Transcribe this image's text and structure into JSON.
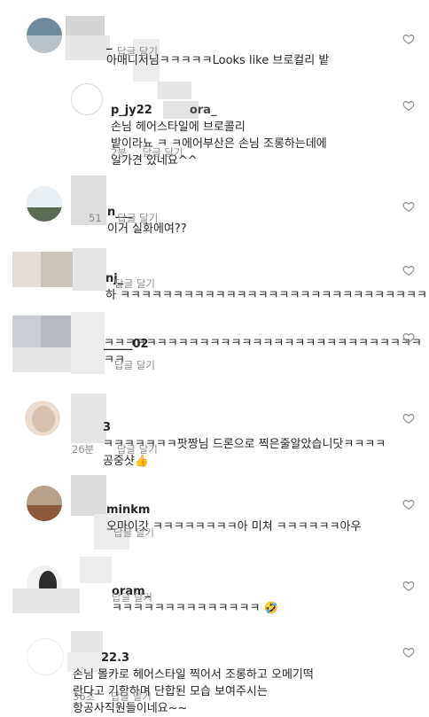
{
  "comments": [
    {
      "username": "_",
      "text": "아매니저님ㅋㅋㅋㅋㅋLooks like 브로컬리 밭",
      "time": "",
      "reply_label": "답글 달기"
    },
    {
      "username": "p_jy22",
      "username_tail": "ora_",
      "text": "손님 헤어스타일에 브로콜리\n밭이라뇨 ㅋ                ㅋ에어부산은 손님 조롱하는데에\n일가견 있네요^^",
      "time": "2분",
      "reply_label": "답글 달기"
    },
    {
      "username": "n___",
      "text": "이거 실화에여??",
      "time": "51",
      "reply_label": "답글 달기"
    },
    {
      "username": "nj_",
      "text": "하 ㅋㅋㅋㅋㅋㅋㅋㅋㅋㅋㅋㅋㅋㅋㅋㅋㅋㅋㅋㅋㅋㅋㅋㅋㅋㅋㅋㅋㅋ",
      "time": "",
      "reply_label": "답글 달기"
    },
    {
      "username": "_____02",
      "text": "ㅋㅋㅋㅋㅋㅋㅋㅋㅋㅋㅋㅋㅋㅋㅋㅋㅋㅋㅋㅋㅋㅋㅋㅋㅋㅋㅋㅋㅋㅋㅋㅋ",
      "time": "",
      "reply_label": "답글 달기"
    },
    {
      "username": "3",
      "text": "ㅋㅋㅋㅋㅋㅋㅋ팟짱님 드론으로 찍은줄알았습니닷ㅋㅋㅋㅋ\n공중샷👍",
      "time": "26분",
      "reply_label": "답글 달기"
    },
    {
      "username": "minkm",
      "text": "오마이갓 ㅋㅋㅋㅋㅋㅋㅋㅋ아 미쳐 ㅋㅋㅋㅋㅋㅋ아우",
      "time": "",
      "reply_label": "답글 달기"
    },
    {
      "username": "oram_",
      "text": "ㅋㅋㅋㅋㅋㅋㅋㅋㅋㅋㅋㅋㅋㅋ 🤣",
      "time": "",
      "reply_label": "답글 달기"
    },
    {
      "username": "22.3",
      "text": "손님 몰카로 헤어스타일 찍어서 조롱하고 오메기떡\n  란다고 기함하며 단합된 모습 보여주시는\n항공사직원들이네요~~",
      "time": "36초",
      "reply_label": "답글 달기"
    }
  ],
  "colors": {
    "text": "#262626",
    "meta": "#8e8e8e",
    "heart_stroke": "#8e8e8e"
  },
  "icons": {
    "like": "heart-outline-icon"
  }
}
